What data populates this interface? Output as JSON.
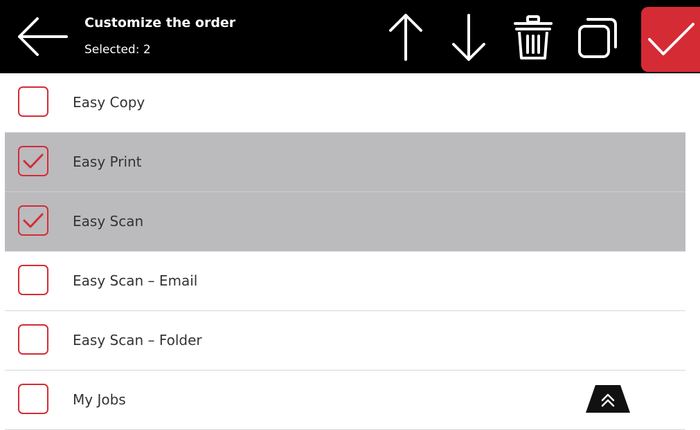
{
  "header": {
    "title": "Customize the order",
    "subtitle": "Selected: 2"
  },
  "toolbar": {
    "icons": [
      "arrow-up-icon",
      "arrow-down-icon",
      "trash-icon",
      "duplicate-icon",
      "checkmark-icon"
    ]
  },
  "items": [
    {
      "label": "Easy Copy",
      "checked": false
    },
    {
      "label": "Easy Print",
      "checked": true
    },
    {
      "label": "Easy Scan",
      "checked": true
    },
    {
      "label": "Easy Scan – Email",
      "checked": false
    },
    {
      "label": "Easy Scan – Folder",
      "checked": false
    },
    {
      "label": "My Jobs",
      "checked": false
    }
  ],
  "colors": {
    "header_bg": "#000000",
    "accent": "#d52b35",
    "selected_row_bg": "#bbbabd",
    "text": "#333333"
  }
}
